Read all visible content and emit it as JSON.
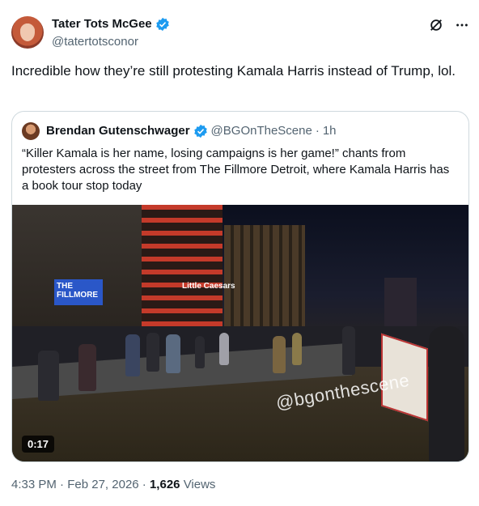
{
  "author": {
    "display_name": "Tater Tots McGee",
    "handle": "@tatertotsconor",
    "verified": true
  },
  "header_actions": {
    "grok_icon": "grok-icon",
    "more_icon": "more-icon"
  },
  "tweet": {
    "text": "Incredible how they’re still protesting Kamala Harris instead of Trump, lol."
  },
  "quote": {
    "display_name": "Brendan Gutenschwager",
    "handle": "@BGOnTheScene",
    "separator": "·",
    "time": "1h",
    "verified": true,
    "text": "“Killer Kamala is her name, losing campaigns is her game!” chants from protesters across the street from The Fillmore Detroit, where Kamala Harris has a book tour stop today",
    "media": {
      "duration": "0:17",
      "watermark": "@bgonthescene",
      "signage": [
        "THE FILLMORE",
        "Little Caesars"
      ]
    }
  },
  "footer": {
    "time": "4:33 PM",
    "sep1": "·",
    "date": "Feb 27, 2026",
    "sep2": "·",
    "views_count": "1,626",
    "views_label": "Views"
  },
  "colors": {
    "text": "#0f1419",
    "muted": "#536471",
    "verified_blue": "#1d9bf0",
    "border": "#cfd9de"
  }
}
